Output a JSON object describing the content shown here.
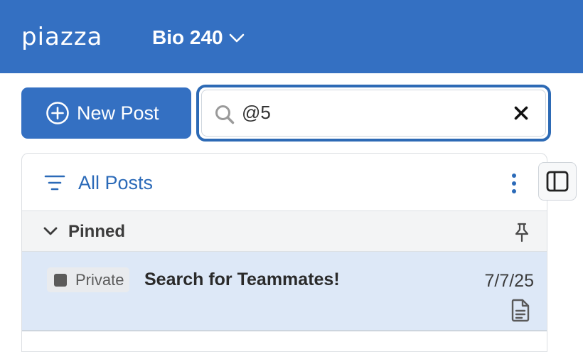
{
  "header": {
    "logo_text": "piazza",
    "course_name": "Bio 240",
    "bg_color": "#3470c2"
  },
  "toolbar": {
    "new_post_label": "New Post",
    "search_value": "@5",
    "search_icon": "search-icon",
    "clear_icon": "close-icon"
  },
  "feed": {
    "filter_label": "All Posts",
    "pinned_section_label": "Pinned",
    "posts": [
      {
        "visibility": "Private",
        "title": "Search for Teammates!",
        "date": "7/7/25",
        "type_icon": "document-icon"
      }
    ]
  },
  "colors": {
    "accent": "#3470c2",
    "selected_row": "#dde8f7",
    "section_bg": "#f3f4f5"
  }
}
